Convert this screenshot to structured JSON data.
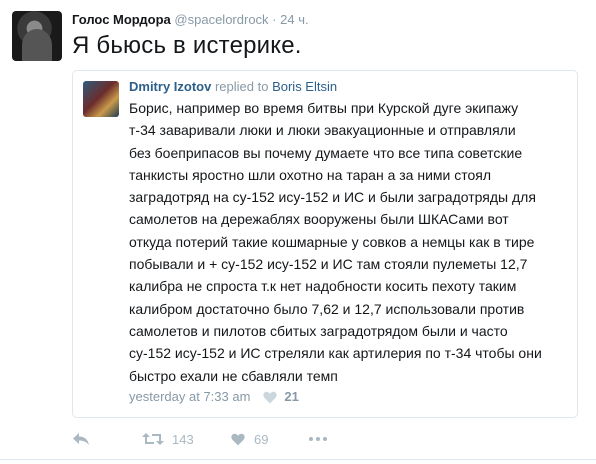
{
  "tweet": {
    "author_name": "Голос Мордора",
    "author_handle": "@spacelordrock",
    "separator": "·",
    "time": "24 ч.",
    "text": "Я бьюсь в истерике."
  },
  "quote": {
    "author_name": "Dmitry Izotov",
    "replied_label": "replied to",
    "replied_to": "Boris Eltsin",
    "lines": [
      "Борис, например во время битвы при Курской дуге экипажу",
      "т-34 заваривали люки и люки эвакуационные и отправляли",
      "без боеприпасов вы почему думаете что все типа советские",
      "танкисты яростно шли охотно на таран а за ними стоял",
      "заградотряд на су-152 ису-152 и ИС и были заградотряды для",
      "самолетов на дережаблях вооружены были ШКАСами вот",
      "откуда потерий такие кошмарные у совков а немцы как в тире",
      "побывали и + су-152 ису-152 и ИС там стояли пулеметы 12,7",
      "калибра не спроста т.к нет надобности косить пехоту таким",
      "калибром достаточно было 7,62 и 12,7 использовали против",
      "самолетов и пилотов сбитых заградотрядом были и часто",
      "су-152 ису-152 и ИС стреляли как артилерия по т-34 чтобы они",
      "быстро ехали не сбавляли темп"
    ],
    "timestamp": "yesterday at 7:33 am",
    "likes": "21"
  },
  "actions": {
    "reply_icon": "reply-icon",
    "retweet_count": "143",
    "like_count": "69",
    "more_icon": "more-icon"
  },
  "colors": {
    "link": "#2c5f8a",
    "muted": "#8899a6",
    "action": "#aab8c2"
  }
}
